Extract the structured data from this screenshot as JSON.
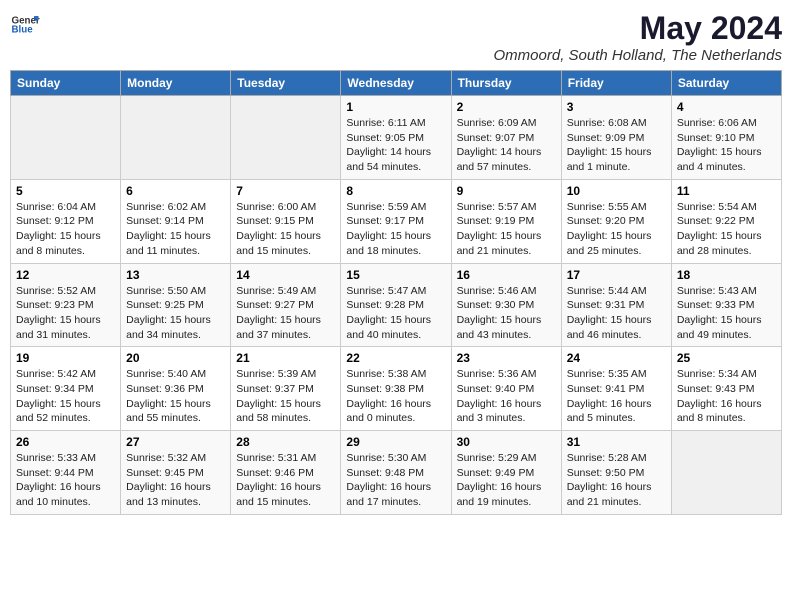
{
  "header": {
    "logo_general": "General",
    "logo_blue": "Blue",
    "main_title": "May 2024",
    "subtitle": "Ommoord, South Holland, The Netherlands"
  },
  "days_of_week": [
    "Sunday",
    "Monday",
    "Tuesday",
    "Wednesday",
    "Thursday",
    "Friday",
    "Saturday"
  ],
  "weeks": [
    [
      {
        "day": "",
        "info": ""
      },
      {
        "day": "",
        "info": ""
      },
      {
        "day": "",
        "info": ""
      },
      {
        "day": "1",
        "info": "Sunrise: 6:11 AM\nSunset: 9:05 PM\nDaylight: 14 hours\nand 54 minutes."
      },
      {
        "day": "2",
        "info": "Sunrise: 6:09 AM\nSunset: 9:07 PM\nDaylight: 14 hours\nand 57 minutes."
      },
      {
        "day": "3",
        "info": "Sunrise: 6:08 AM\nSunset: 9:09 PM\nDaylight: 15 hours\nand 1 minute."
      },
      {
        "day": "4",
        "info": "Sunrise: 6:06 AM\nSunset: 9:10 PM\nDaylight: 15 hours\nand 4 minutes."
      }
    ],
    [
      {
        "day": "5",
        "info": "Sunrise: 6:04 AM\nSunset: 9:12 PM\nDaylight: 15 hours\nand 8 minutes."
      },
      {
        "day": "6",
        "info": "Sunrise: 6:02 AM\nSunset: 9:14 PM\nDaylight: 15 hours\nand 11 minutes."
      },
      {
        "day": "7",
        "info": "Sunrise: 6:00 AM\nSunset: 9:15 PM\nDaylight: 15 hours\nand 15 minutes."
      },
      {
        "day": "8",
        "info": "Sunrise: 5:59 AM\nSunset: 9:17 PM\nDaylight: 15 hours\nand 18 minutes."
      },
      {
        "day": "9",
        "info": "Sunrise: 5:57 AM\nSunset: 9:19 PM\nDaylight: 15 hours\nand 21 minutes."
      },
      {
        "day": "10",
        "info": "Sunrise: 5:55 AM\nSunset: 9:20 PM\nDaylight: 15 hours\nand 25 minutes."
      },
      {
        "day": "11",
        "info": "Sunrise: 5:54 AM\nSunset: 9:22 PM\nDaylight: 15 hours\nand 28 minutes."
      }
    ],
    [
      {
        "day": "12",
        "info": "Sunrise: 5:52 AM\nSunset: 9:23 PM\nDaylight: 15 hours\nand 31 minutes."
      },
      {
        "day": "13",
        "info": "Sunrise: 5:50 AM\nSunset: 9:25 PM\nDaylight: 15 hours\nand 34 minutes."
      },
      {
        "day": "14",
        "info": "Sunrise: 5:49 AM\nSunset: 9:27 PM\nDaylight: 15 hours\nand 37 minutes."
      },
      {
        "day": "15",
        "info": "Sunrise: 5:47 AM\nSunset: 9:28 PM\nDaylight: 15 hours\nand 40 minutes."
      },
      {
        "day": "16",
        "info": "Sunrise: 5:46 AM\nSunset: 9:30 PM\nDaylight: 15 hours\nand 43 minutes."
      },
      {
        "day": "17",
        "info": "Sunrise: 5:44 AM\nSunset: 9:31 PM\nDaylight: 15 hours\nand 46 minutes."
      },
      {
        "day": "18",
        "info": "Sunrise: 5:43 AM\nSunset: 9:33 PM\nDaylight: 15 hours\nand 49 minutes."
      }
    ],
    [
      {
        "day": "19",
        "info": "Sunrise: 5:42 AM\nSunset: 9:34 PM\nDaylight: 15 hours\nand 52 minutes."
      },
      {
        "day": "20",
        "info": "Sunrise: 5:40 AM\nSunset: 9:36 PM\nDaylight: 15 hours\nand 55 minutes."
      },
      {
        "day": "21",
        "info": "Sunrise: 5:39 AM\nSunset: 9:37 PM\nDaylight: 15 hours\nand 58 minutes."
      },
      {
        "day": "22",
        "info": "Sunrise: 5:38 AM\nSunset: 9:38 PM\nDaylight: 16 hours\nand 0 minutes."
      },
      {
        "day": "23",
        "info": "Sunrise: 5:36 AM\nSunset: 9:40 PM\nDaylight: 16 hours\nand 3 minutes."
      },
      {
        "day": "24",
        "info": "Sunrise: 5:35 AM\nSunset: 9:41 PM\nDaylight: 16 hours\nand 5 minutes."
      },
      {
        "day": "25",
        "info": "Sunrise: 5:34 AM\nSunset: 9:43 PM\nDaylight: 16 hours\nand 8 minutes."
      }
    ],
    [
      {
        "day": "26",
        "info": "Sunrise: 5:33 AM\nSunset: 9:44 PM\nDaylight: 16 hours\nand 10 minutes."
      },
      {
        "day": "27",
        "info": "Sunrise: 5:32 AM\nSunset: 9:45 PM\nDaylight: 16 hours\nand 13 minutes."
      },
      {
        "day": "28",
        "info": "Sunrise: 5:31 AM\nSunset: 9:46 PM\nDaylight: 16 hours\nand 15 minutes."
      },
      {
        "day": "29",
        "info": "Sunrise: 5:30 AM\nSunset: 9:48 PM\nDaylight: 16 hours\nand 17 minutes."
      },
      {
        "day": "30",
        "info": "Sunrise: 5:29 AM\nSunset: 9:49 PM\nDaylight: 16 hours\nand 19 minutes."
      },
      {
        "day": "31",
        "info": "Sunrise: 5:28 AM\nSunset: 9:50 PM\nDaylight: 16 hours\nand 21 minutes."
      },
      {
        "day": "",
        "info": ""
      }
    ]
  ]
}
